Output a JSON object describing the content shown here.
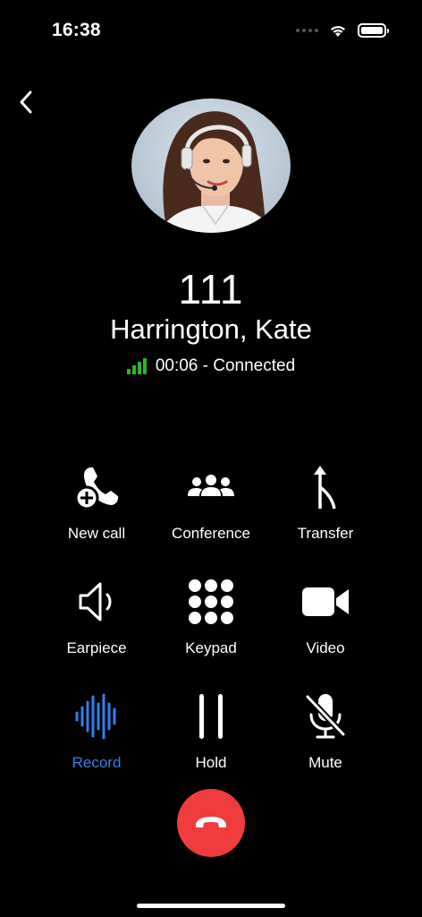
{
  "status_bar": {
    "time": "16:38"
  },
  "caller": {
    "number": "111",
    "name": "Harrington, Kate",
    "status": "00:06 - Connected"
  },
  "actions": [
    {
      "label": "New call",
      "icon": "new-call-icon"
    },
    {
      "label": "Conference",
      "icon": "conference-icon"
    },
    {
      "label": "Transfer",
      "icon": "transfer-icon"
    },
    {
      "label": "Earpiece",
      "icon": "speaker-icon"
    },
    {
      "label": "Keypad",
      "icon": "keypad-icon"
    },
    {
      "label": "Video",
      "icon": "video-icon"
    },
    {
      "label": "Record",
      "icon": "waveform-icon",
      "active": true
    },
    {
      "label": "Hold",
      "icon": "pause-icon"
    },
    {
      "label": "Mute",
      "icon": "microphone-slash-icon"
    }
  ],
  "colors": {
    "background": "#000000",
    "accent": "#2f80ed",
    "end_call": "#f03c3c",
    "signal": "#2bb52b"
  }
}
